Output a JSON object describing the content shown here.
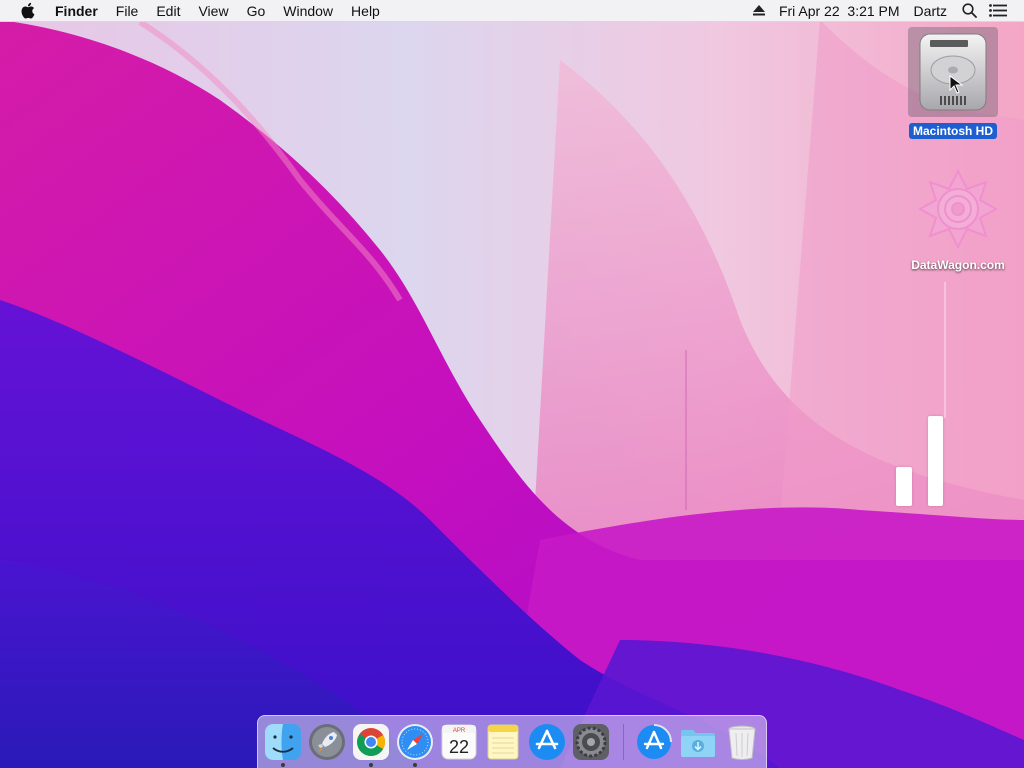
{
  "menubar": {
    "app_name": "Finder",
    "menus": [
      "File",
      "Edit",
      "View",
      "Go",
      "Window",
      "Help"
    ],
    "datetime": "Fri Apr 22  3:21 PM",
    "user": "Dartz",
    "icons": [
      "apple-logo-icon",
      "eject-icon",
      "spotlight-search-icon",
      "control-center-icon"
    ]
  },
  "desktop": {
    "items": [
      {
        "label": "Macintosh HD",
        "icon": "hard-drive-icon",
        "selected": true
      },
      {
        "label": "DataWagon.com",
        "icon": "datawagon-logo-icon",
        "selected": false
      }
    ]
  },
  "dock": {
    "apps": [
      {
        "name": "Finder",
        "icon": "finder-icon",
        "running": true
      },
      {
        "name": "Launchpad",
        "icon": "launchpad-icon",
        "running": false
      },
      {
        "name": "Google Chrome",
        "icon": "chrome-icon",
        "running": true
      },
      {
        "name": "Safari",
        "icon": "safari-icon",
        "running": true
      },
      {
        "name": "Calendar",
        "icon": "calendar-icon",
        "running": false,
        "month": "APR",
        "day": "22"
      },
      {
        "name": "Notes",
        "icon": "notes-icon",
        "running": false
      },
      {
        "name": "App Store",
        "icon": "app-store-icon",
        "running": false
      },
      {
        "name": "System Preferences",
        "icon": "system-preferences-icon",
        "running": false
      },
      {
        "name": "App Store Downloads",
        "icon": "app-store-download-icon",
        "running": false
      },
      {
        "name": "Downloads",
        "icon": "downloads-folder-icon",
        "running": false
      },
      {
        "name": "Trash",
        "icon": "trash-icon",
        "running": false
      }
    ]
  },
  "colors": {
    "menubar_bg": "#f2f2f4",
    "selection_blue": "#1d5fd1",
    "wallpaper_magenta": "#c81ab8",
    "wallpaper_purple": "#4a0fd0",
    "wallpaper_pink": "#f6a5c8"
  }
}
